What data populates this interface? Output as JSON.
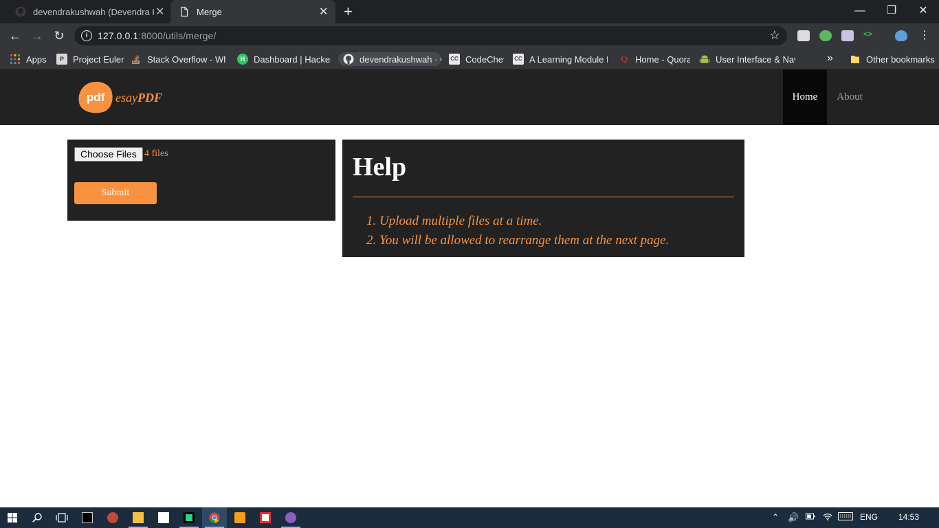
{
  "browser": {
    "tabs": [
      {
        "title": "devendrakushwah (Devendra Kus",
        "icon": "github-icon",
        "active": false
      },
      {
        "title": "Merge",
        "icon": "page-icon",
        "active": true
      }
    ],
    "new_tab_symbol": "+",
    "window_controls": {
      "minimize": "—",
      "restore": "❐",
      "close": "✕"
    },
    "nav": {
      "back": "←",
      "forward": "→",
      "reload": "↻"
    },
    "url": {
      "host": "127.0.0.1",
      "path": ":8000/utils/merge/"
    },
    "info_symbol": "i",
    "bookmark_star": "☆",
    "bookmarks": [
      {
        "label": "Apps",
        "icon": "apps-grid-icon"
      },
      {
        "label": "Project Euler",
        "icon": "project-euler-icon"
      },
      {
        "label": "Stack Overflow - Whe",
        "icon": "stackoverflow-icon"
      },
      {
        "label": "Dashboard | HackerR",
        "icon": "hackerrank-icon",
        "glyph": "H"
      },
      {
        "label": "devendrakushwah · G",
        "icon": "github-icon"
      },
      {
        "label": "CodeChef",
        "icon": "codechef-icon",
        "glyph": "CC"
      },
      {
        "label": "A Learning Module fo",
        "icon": "learning-module-icon",
        "glyph": "CC"
      },
      {
        "label": "Home - Quora",
        "icon": "quora-icon",
        "glyph": "Q"
      },
      {
        "label": "User Interface & Navi",
        "icon": "android-icon"
      }
    ],
    "bookmarks_more": "»",
    "other_bookmarks": "Other bookmarks"
  },
  "site": {
    "logo": {
      "badge": "pdf",
      "name_light": "esay",
      "name_bold": "PDF"
    },
    "nav": {
      "home": "Home",
      "about": "About"
    }
  },
  "upload": {
    "choose_label": "Choose Files",
    "file_count": "4 files",
    "submit_label": "Submit"
  },
  "help": {
    "title": "Help",
    "items": [
      "1. Upload multiple files at a time.",
      "2. You will be allowed to rearrange them at the next page."
    ]
  },
  "taskbar": {
    "language": "ENG",
    "time": "14:53"
  },
  "colors": {
    "accent": "#f89240",
    "panel": "#222222",
    "chrome_dark": "#202124",
    "chrome_toolbar": "#35363a",
    "taskbar": "#1b2c3e"
  }
}
